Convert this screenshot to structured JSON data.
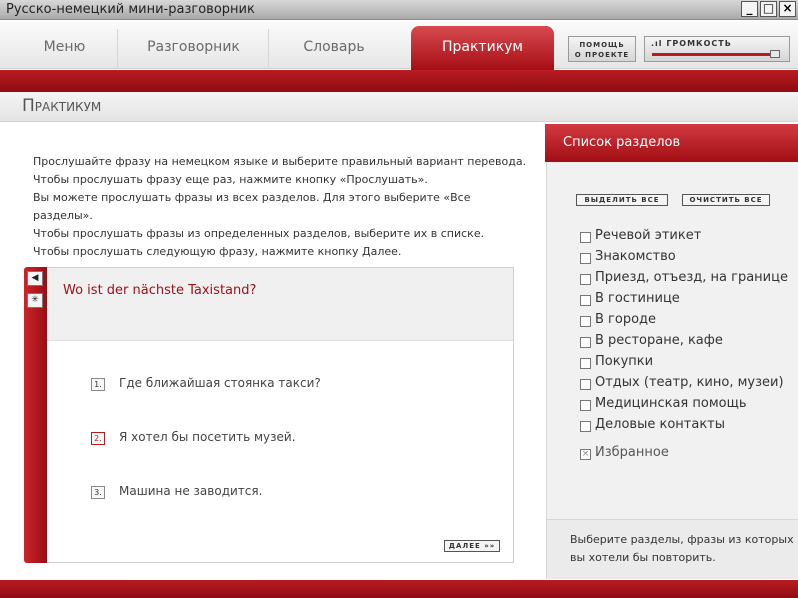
{
  "window": {
    "title": "Русско-немецкий мини-разговорник",
    "min": "_",
    "max": "□",
    "close": "×"
  },
  "nav": {
    "tabs": [
      "Меню",
      "Разговорник",
      "Словарь",
      "Практикум"
    ],
    "help_line1": "ПОМОЩЬ",
    "help_line2": "О ПРОЕКТЕ",
    "volume_label": "ГРОМКОСТЬ",
    "volume_level": 1.0
  },
  "page": {
    "title": "Практикум"
  },
  "instructions": [
    "Прослушайте фразу на немецком языке и выберите правильный вариант перевода.",
    "Чтобы прослушать фразу еще раз, нажмите кнопку «Прослушать».",
    "Вы можете прослушать фразы из всех разделов. Для этого выберите «Все разделы».",
    "Чтобы прослушать фразы из определенных разделов, выберите их в списке.",
    "Чтобы прослушать следующую фразу, нажмите кнопку Далее."
  ],
  "quiz": {
    "question": "Wo ist der nächste Taxistand?",
    "options": [
      {
        "num": "1.",
        "text": "Где ближайшая стоянка такси?"
      },
      {
        "num": "2.",
        "text": "Я хотел бы посетить музей."
      },
      {
        "num": "3.",
        "text": "Машина не заводится."
      }
    ],
    "next_label": "ДАЛЕЕ »»",
    "play_icon": "◀",
    "star_icon": "✳"
  },
  "panel": {
    "header": "Список разделов",
    "select_all": "ВЫДЕЛИТЬ ВСЕ",
    "clear_all": "ОЧИСТИТЬ ВСЕ",
    "categories": [
      "Речевой этикет",
      "Знакомство",
      "Приезд, отъезд, на границе",
      "В гостинице",
      "В городе",
      "В ресторане, кафе",
      "Покупки",
      "Отдых (театр, кино, музеи)",
      "Медицинская помощь",
      "Деловые контакты"
    ],
    "favorites": "Избранное",
    "footer": "Выберите разделы, фразы из которых вы хотели бы повторить."
  },
  "colors": {
    "accent": "#b81c22",
    "question": "#a01018"
  }
}
